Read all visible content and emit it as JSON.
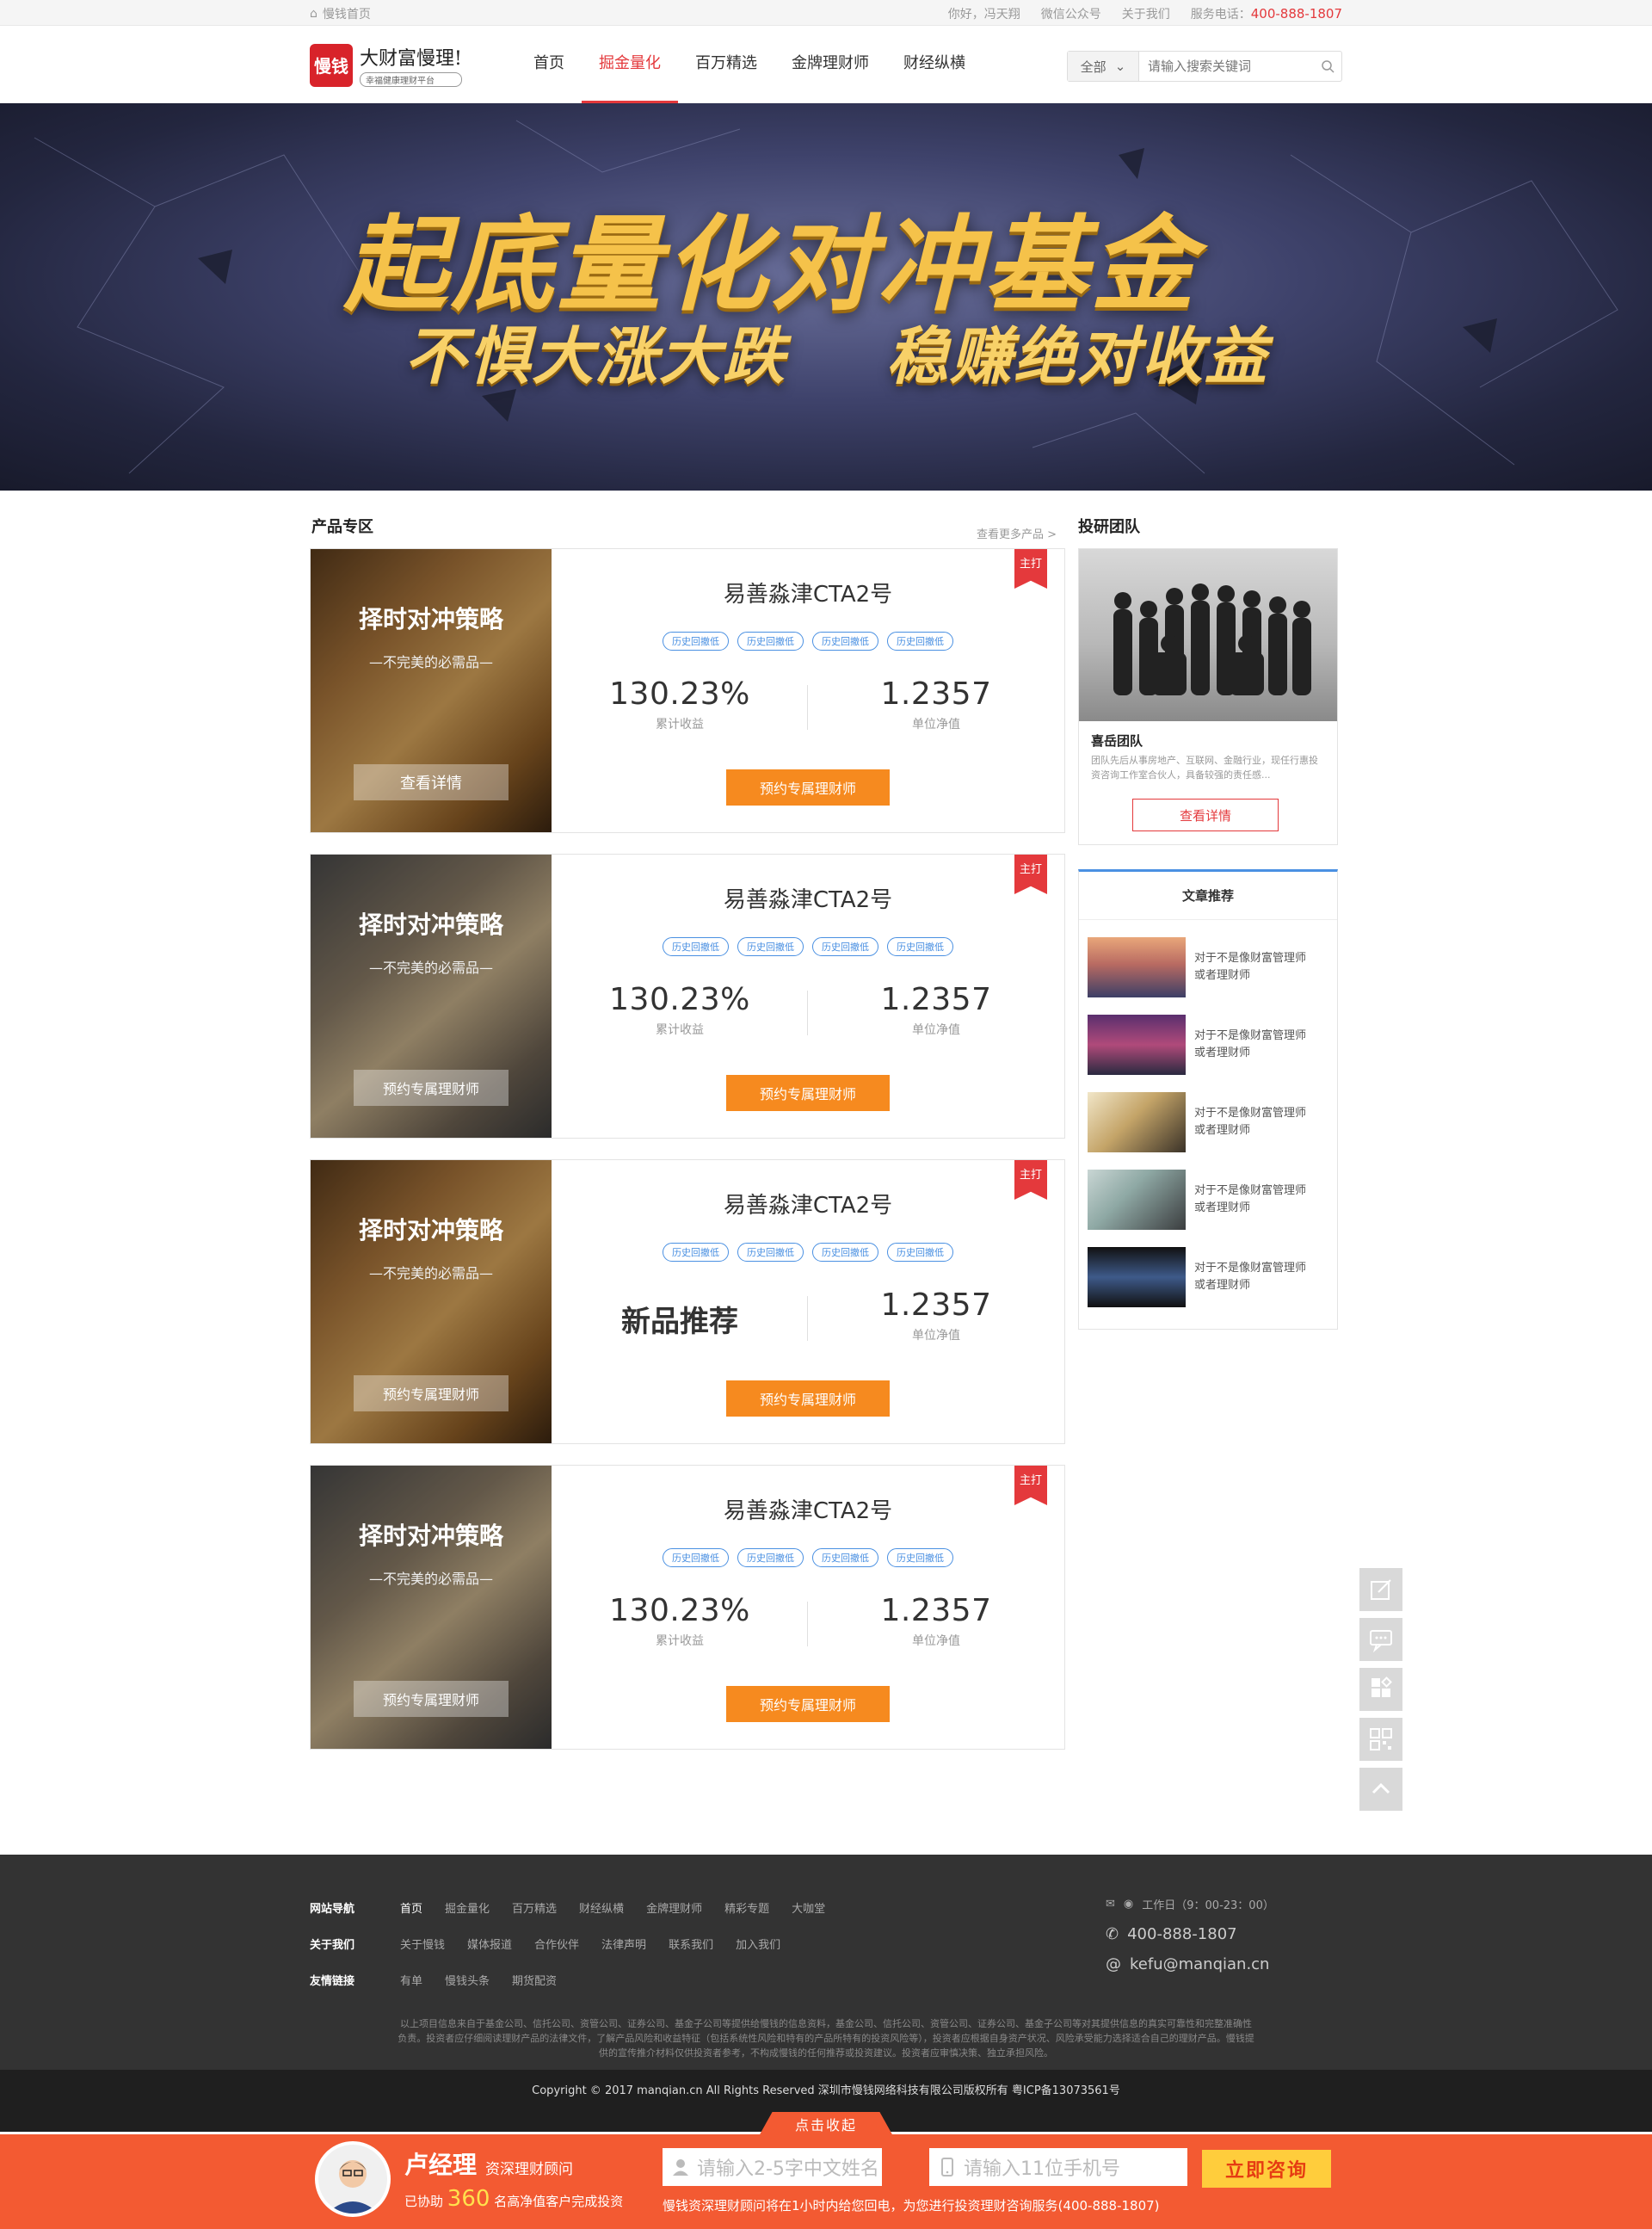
{
  "topbar": {
    "home": "慢钱首页",
    "greeting": "你好，冯天翔",
    "wechat": "微信公众号",
    "about": "关于我们",
    "service_label": "服务电话：",
    "service_phone": "400-888-1807"
  },
  "header": {
    "logo_box": "慢钱",
    "logo_main": "大财富慢理!",
    "logo_sub": "幸福健康理财平台",
    "nav": [
      "首页",
      "掘金量化",
      "百万精选",
      "金牌理财师",
      "财经纵横"
    ],
    "search_select": "全部",
    "search_placeholder": "请输入搜索关键词"
  },
  "banner": {
    "line1": "起底量化对冲基金",
    "line2": "不惧大涨大跌",
    "line3": "稳赚绝对收益"
  },
  "products": {
    "title": "产品专区",
    "more": "查看更多产品 >",
    "items": [
      {
        "img_title": "择时对冲策略",
        "img_sub": "—不完美的必需品—",
        "img_btn": "查看详情",
        "name": "易善淼津CTA2号",
        "tags": [
          "历史回撤低",
          "历史回撤低",
          "历史回撤低",
          "历史回撤低"
        ],
        "ribbon": "主打",
        "stat1": "130.23%",
        "stat1_label": "累计收益",
        "stat2": "1.2357",
        "stat2_label": "单位净值",
        "btn": "预约专属理财师"
      },
      {
        "img_title": "择时对冲策略",
        "img_sub": "—不完美的必需品—",
        "img_btn": "预约专属理财师",
        "name": "易善淼津CTA2号",
        "tags": [
          "历史回撤低",
          "历史回撤低",
          "历史回撤低",
          "历史回撤低"
        ],
        "ribbon": "主打",
        "stat1": "130.23%",
        "stat1_label": "累计收益",
        "stat2": "1.2357",
        "stat2_label": "单位净值",
        "btn": "预约专属理财师"
      },
      {
        "img_title": "择时对冲策略",
        "img_sub": "—不完美的必需品—",
        "img_btn": "预约专属理财师",
        "name": "易善淼津CTA2号",
        "tags": [
          "历史回撤低",
          "历史回撤低",
          "历史回撤低",
          "历史回撤低"
        ],
        "ribbon": "主打",
        "stat1": "新品推荐",
        "stat1_label": "",
        "stat2": "1.2357",
        "stat2_label": "单位净值",
        "btn": "预约专属理财师"
      },
      {
        "img_title": "择时对冲策略",
        "img_sub": "—不完美的必需品—",
        "img_btn": "预约专属理财师",
        "name": "易善淼津CTA2号",
        "tags": [
          "历史回撤低",
          "历史回撤低",
          "历史回撤低",
          "历史回撤低"
        ],
        "ribbon": "主打",
        "stat1": "130.23%",
        "stat1_label": "累计收益",
        "stat2": "1.2357",
        "stat2_label": "单位净值",
        "btn": "预约专属理财师"
      }
    ]
  },
  "team": {
    "title": "投研团队",
    "name": "喜岳团队",
    "desc": "团队先后从事房地产、互联网、金融行业，现任行惠投资咨询工作室合伙人，具备较强的责任感...",
    "btn": "查看详情"
  },
  "articles": {
    "title": "文章推荐",
    "items": [
      {
        "line1": "对于不是像财富管理师",
        "line2": "或者理财师"
      },
      {
        "line1": "对于不是像财富管理师",
        "line2": "或者理财师"
      },
      {
        "line1": "对于不是像财富管理师",
        "line2": "或者理财师"
      },
      {
        "line1": "对于不是像财富管理师",
        "line2": "或者理财师"
      },
      {
        "line1": "对于不是像财富管理师",
        "line2": "或者理财师"
      }
    ]
  },
  "footer": {
    "rows": [
      {
        "head": "网站导航",
        "links": [
          "首页",
          "掘金量化",
          "百万精选",
          "财经纵横",
          "金牌理财师",
          "精彩专题",
          "大咖堂"
        ]
      },
      {
        "head": "关于我们",
        "links": [
          "关于慢钱",
          "媒体报道",
          "合作伙伴",
          "法律声明",
          "联系我们",
          "加入我们"
        ]
      },
      {
        "head": "友情链接",
        "links": [
          "有单",
          "慢钱头条",
          "期货配资"
        ]
      }
    ],
    "hours": "工作日（9：00-23：00）",
    "phone": "400-888-1807",
    "email": "kefu@manqian.cn",
    "note": "以上项目信息来自于基金公司、信托公司、资管公司、证券公司、基金子公司等提供给慢钱的信息资料，基金公司、信托公司、资管公司、证券公司、基金子公司等对其提供信息的真实可靠性和完整准确性负责。投资者应仔细阅读理财产品的法律文件，了解产品风险和收益特征（包括系统性风险和特有的产品所特有的投资风险等），投资者应根据自身资产状况、风险承受能力选择适合自己的理财产品。慢钱提供的宣传推介材料仅供投资者参考，不构成慢钱的任何推荐或投资建议。投资者应审慎决策、独立承担风险。",
    "copyright": "Copyright © 2017 manqian.cn All Rights Reserved 深圳市慢钱网络科技有限公司版权所有 粤ICP备13073561号"
  },
  "bottom": {
    "tab": "点击收起",
    "manager": "卢经理",
    "manager_title": "资深理财顾问",
    "assist_pre": "已协助",
    "assist_count": "360",
    "assist_post": "名高净值客户完成投资",
    "name_placeholder": "请输入2-5字中文姓名",
    "phone_placeholder": "请输入11位手机号",
    "consult": "立即咨询",
    "note": "慢钱资深理财顾问将在1小时内给您回电，为您进行投资理财咨询服务(400-888-1807)"
  }
}
